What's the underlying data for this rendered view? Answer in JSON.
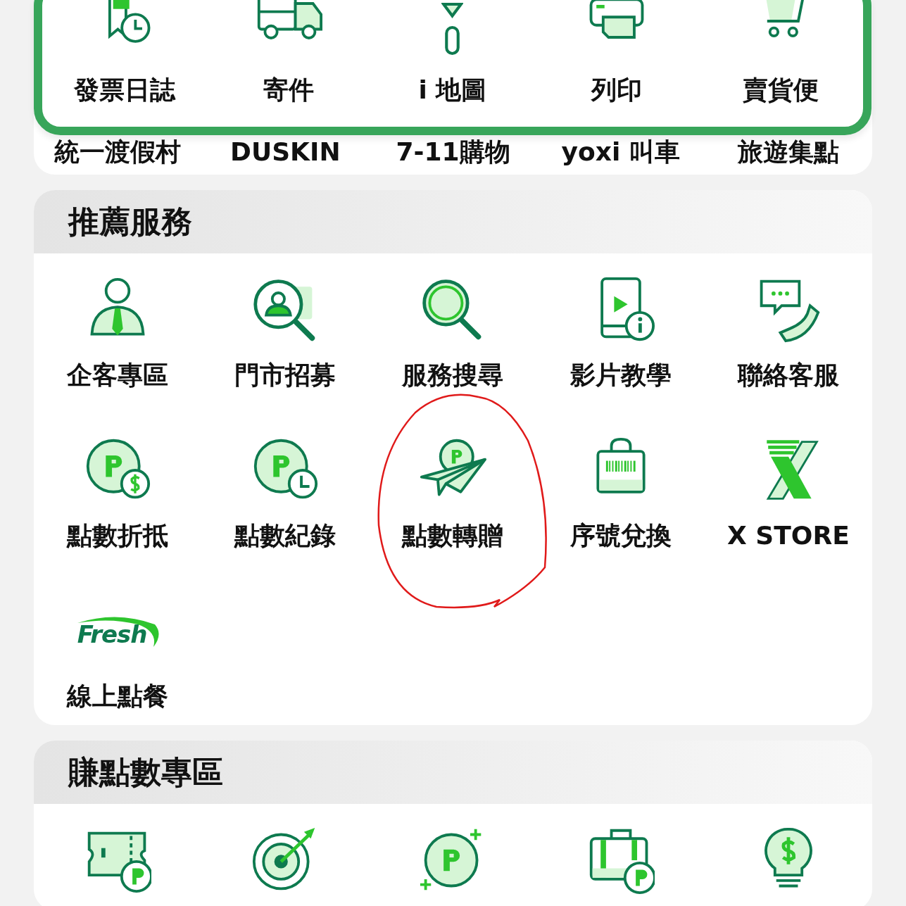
{
  "hidden_row": {
    "labels": [
      "統一渡假村",
      "DUSKIN",
      "7-11購物",
      "yoxi 叫車",
      "旅遊集點"
    ]
  },
  "top_tiles": [
    {
      "label": "發票日誌",
      "kind": "receipt"
    },
    {
      "label": "寄件",
      "kind": "truck"
    },
    {
      "label": "i 地圖",
      "kind": "pin"
    },
    {
      "label": "列印",
      "kind": "printer"
    },
    {
      "label": "賣貨便",
      "kind": "cart"
    }
  ],
  "sections": [
    {
      "title": "推薦服務",
      "items": [
        {
          "label": "企客專區",
          "kind": "businessman"
        },
        {
          "label": "門市招募",
          "kind": "recruit"
        },
        {
          "label": "服務搜尋",
          "kind": "search"
        },
        {
          "label": "影片教學",
          "kind": "video"
        },
        {
          "label": "聯絡客服",
          "kind": "support"
        },
        {
          "label": "點數折抵",
          "kind": "points-dollar"
        },
        {
          "label": "點數紀錄",
          "kind": "points-history"
        },
        {
          "label": "點數轉贈",
          "kind": "points-plane"
        },
        {
          "label": "序號兌換",
          "kind": "barcode-bag"
        },
        {
          "label": "X STORE",
          "kind": "x-logo"
        },
        {
          "label": "線上點餐",
          "kind": "fresh",
          "logo_text": "Fresh"
        }
      ]
    },
    {
      "title": "賺點數專區",
      "items": [
        {
          "kind": "ticket"
        },
        {
          "kind": "target"
        },
        {
          "kind": "points-plus"
        },
        {
          "kind": "suitcase"
        },
        {
          "kind": "bulb"
        }
      ]
    }
  ]
}
